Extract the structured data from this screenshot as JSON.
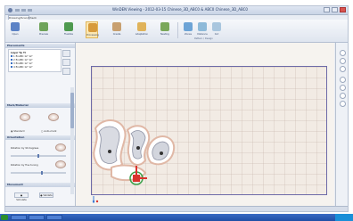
{
  "window": {
    "title": "WinDEN Viewing - 2012-03-15 Chinese_3D_ABC0 & ABC0 Chinese_3D_ABC0",
    "tab": "Drawing/Scan/Check"
  },
  "ribbon": {
    "buttons": [
      {
        "label": "Open",
        "icon": "open-icon"
      },
      {
        "label": "Preview",
        "icon": "preview-icon"
      },
      {
        "label": "Flexible",
        "icon": "flexible-icon"
      },
      {
        "label": "Processing",
        "icon": "processing-icon"
      },
      {
        "label": "Create",
        "icon": "create-icon"
      },
      {
        "label": "Adaptation",
        "icon": "adaptation-icon"
      },
      {
        "label": "Nesting",
        "icon": "nesting-icon"
      },
      {
        "label": "Zones",
        "icon": "zones-icon"
      },
      {
        "label": "Distance",
        "icon": "distance-icon"
      },
      {
        "label": "Cut",
        "icon": "cut-icon"
      }
    ],
    "group_label": "Pattern / Design"
  },
  "left_panel": {
    "section1_title": "Placements",
    "tree": {
      "header": "Layer   Tp  Tl",
      "rows": [
        "1  EnABC  12'  12'",
        "2  EnABC  12'  12'",
        "3  EnABC  12'  12'",
        "4  EnABC  12'  12'",
        "5  EnABC  12'  12'"
      ]
    },
    "section2_title": "Mark/Material",
    "opt_standard": "Standard",
    "opt_auto": "Auto-mark",
    "section3_title": "Orientation",
    "slider1_label": "Rotation by 90 degrees",
    "slider2_label": "Rotation by fine tuning",
    "section4_title": "Movement",
    "btn_simulate": "Simulate",
    "btn_validate": "Validate"
  },
  "status": {
    "text": ""
  }
}
